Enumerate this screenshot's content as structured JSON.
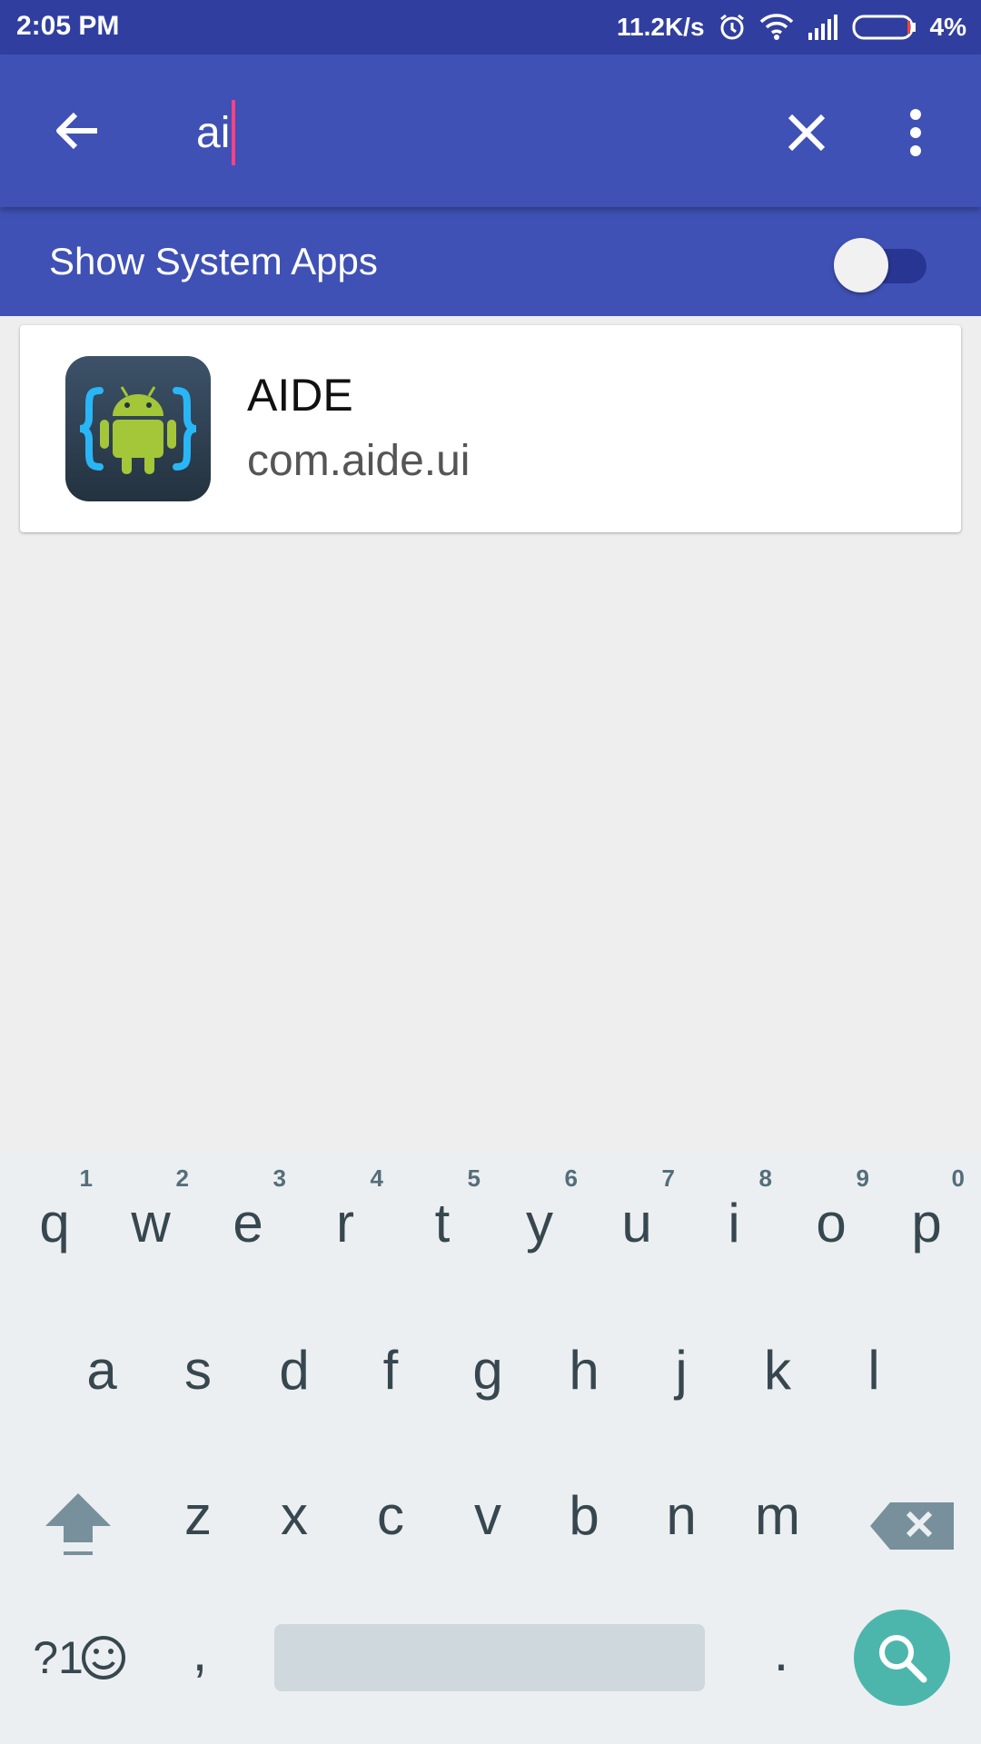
{
  "status_bar": {
    "time": "2:05 PM",
    "network_speed": "11.2K/s",
    "battery": "4%",
    "icons": [
      "alarm-icon",
      "wifi-icon",
      "signal-icon",
      "battery-icon"
    ]
  },
  "app_bar": {
    "search_value": "ai",
    "back_icon": "arrow-left-icon",
    "clear_icon": "close-icon",
    "more_icon": "more-vert-icon",
    "background": "#3f51b5",
    "status_color": "#303f9f",
    "caret_color": "#ff4081"
  },
  "system_apps": {
    "label": "Show System Apps",
    "enabled": false
  },
  "results": [
    {
      "name": "AIDE",
      "package": "com.aide.ui",
      "icon": "aide-android-icon"
    }
  ],
  "keyboard": {
    "row1": [
      {
        "key": "q",
        "hint": "1"
      },
      {
        "key": "w",
        "hint": "2"
      },
      {
        "key": "e",
        "hint": "3"
      },
      {
        "key": "r",
        "hint": "4"
      },
      {
        "key": "t",
        "hint": "5"
      },
      {
        "key": "y",
        "hint": "6"
      },
      {
        "key": "u",
        "hint": "7"
      },
      {
        "key": "i",
        "hint": "8"
      },
      {
        "key": "o",
        "hint": "9"
      },
      {
        "key": "p",
        "hint": "0"
      }
    ],
    "row2": [
      "a",
      "s",
      "d",
      "f",
      "g",
      "h",
      "j",
      "k",
      "l"
    ],
    "row3": [
      "z",
      "x",
      "c",
      "v",
      "b",
      "n",
      "m"
    ],
    "symbols_label": "?1",
    "comma": ",",
    "period": ".",
    "shift_icon": "shift-icon",
    "backspace_icon": "backspace-icon",
    "emoji_icon": "emoji-icon",
    "action_icon": "search-icon",
    "action_color": "#4db6ac"
  }
}
